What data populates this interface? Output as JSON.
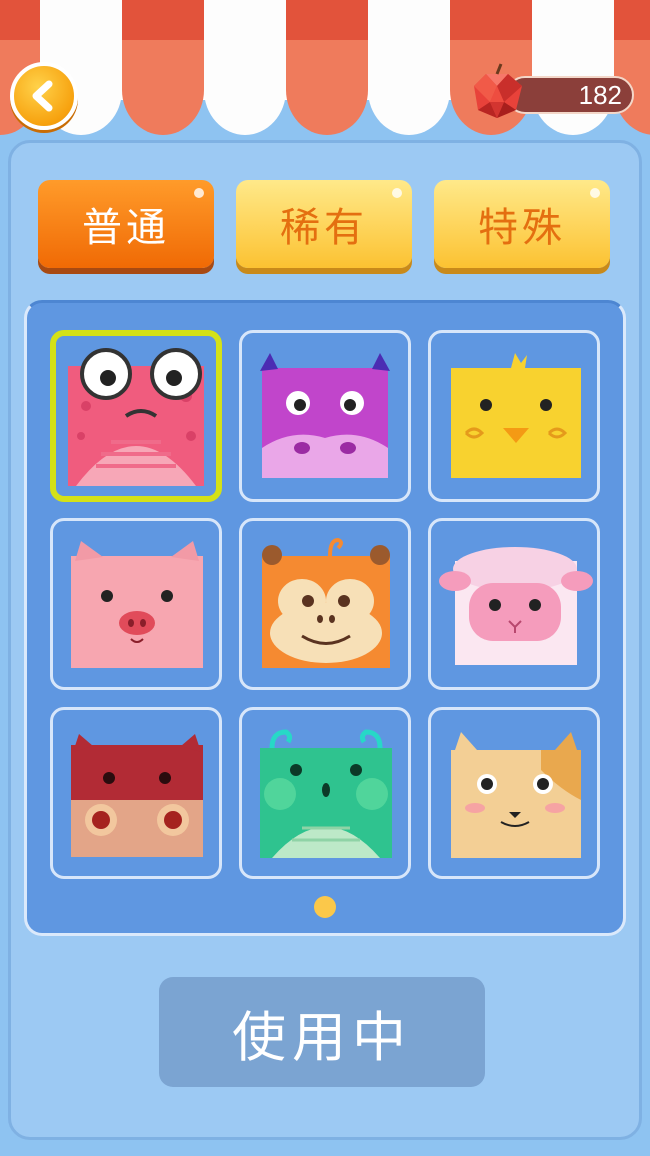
{
  "header": {
    "back_icon": "chevron-left-icon",
    "apple_icon": "apple-icon",
    "apple_count": "182"
  },
  "tabs": [
    {
      "label": "普通",
      "active": true
    },
    {
      "label": "稀有",
      "active": false
    },
    {
      "label": "特殊",
      "active": false
    }
  ],
  "characters": [
    {
      "icon": "frog-face-icon",
      "selected": true
    },
    {
      "icon": "cow-face-icon",
      "selected": false
    },
    {
      "icon": "chick-face-icon",
      "selected": false
    },
    {
      "icon": "pig-face-icon",
      "selected": false
    },
    {
      "icon": "monkey-face-icon",
      "selected": false
    },
    {
      "icon": "sheep-face-icon",
      "selected": false
    },
    {
      "icon": "hippo-face-icon",
      "selected": false
    },
    {
      "icon": "dragon-face-icon",
      "selected": false
    },
    {
      "icon": "dog-face-icon",
      "selected": false
    }
  ],
  "pagination": {
    "current_page": 1,
    "total_pages": 1
  },
  "use_button": {
    "label": "使用中"
  },
  "colors": {
    "active_tab": "#f37a0c",
    "inactive_tab": "#fcc232",
    "grid_bg": "#5f97e1",
    "selected_border": "#d4e117"
  }
}
